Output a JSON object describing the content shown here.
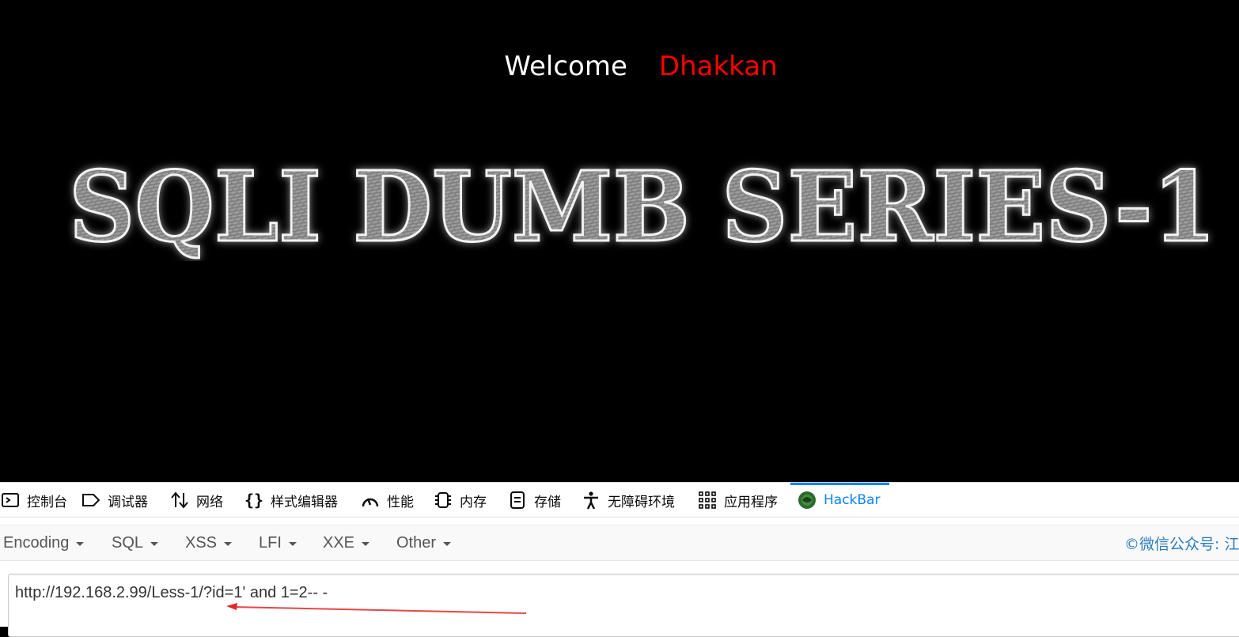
{
  "page": {
    "welcome_word": "Welcome",
    "welcome_name": "Dhakkan",
    "banner_text": "SQLI DUMB SERIES-1",
    "colors": {
      "background": "#000000",
      "welcome": "#ffffff",
      "name": "#ff0000"
    }
  },
  "devtools": {
    "tabs": [
      {
        "label": "控制台",
        "icon": "console-icon"
      },
      {
        "label": "调试器",
        "icon": "debugger-icon"
      },
      {
        "label": "网络",
        "icon": "network-icon"
      },
      {
        "label": "样式编辑器",
        "icon": "style-editor-icon"
      },
      {
        "label": "性能",
        "icon": "performance-icon"
      },
      {
        "label": "内存",
        "icon": "memory-icon"
      },
      {
        "label": "存储",
        "icon": "storage-icon"
      },
      {
        "label": "无障碍环境",
        "icon": "accessibility-icon"
      },
      {
        "label": "应用程序",
        "icon": "application-icon"
      },
      {
        "label": "HackBar",
        "icon": "hackbar-icon",
        "active": true
      }
    ],
    "accent_color": "#0a84ff"
  },
  "hackbar": {
    "menus": [
      {
        "label": "Encoding"
      },
      {
        "label": "SQL"
      },
      {
        "label": "XSS"
      },
      {
        "label": "LFI"
      },
      {
        "label": "XXE"
      },
      {
        "label": "Other"
      }
    ],
    "watermark": "©微信公众号: 江",
    "url_value": "http://192.168.2.99/Less-1/?id=1' and 1=2-- -"
  }
}
